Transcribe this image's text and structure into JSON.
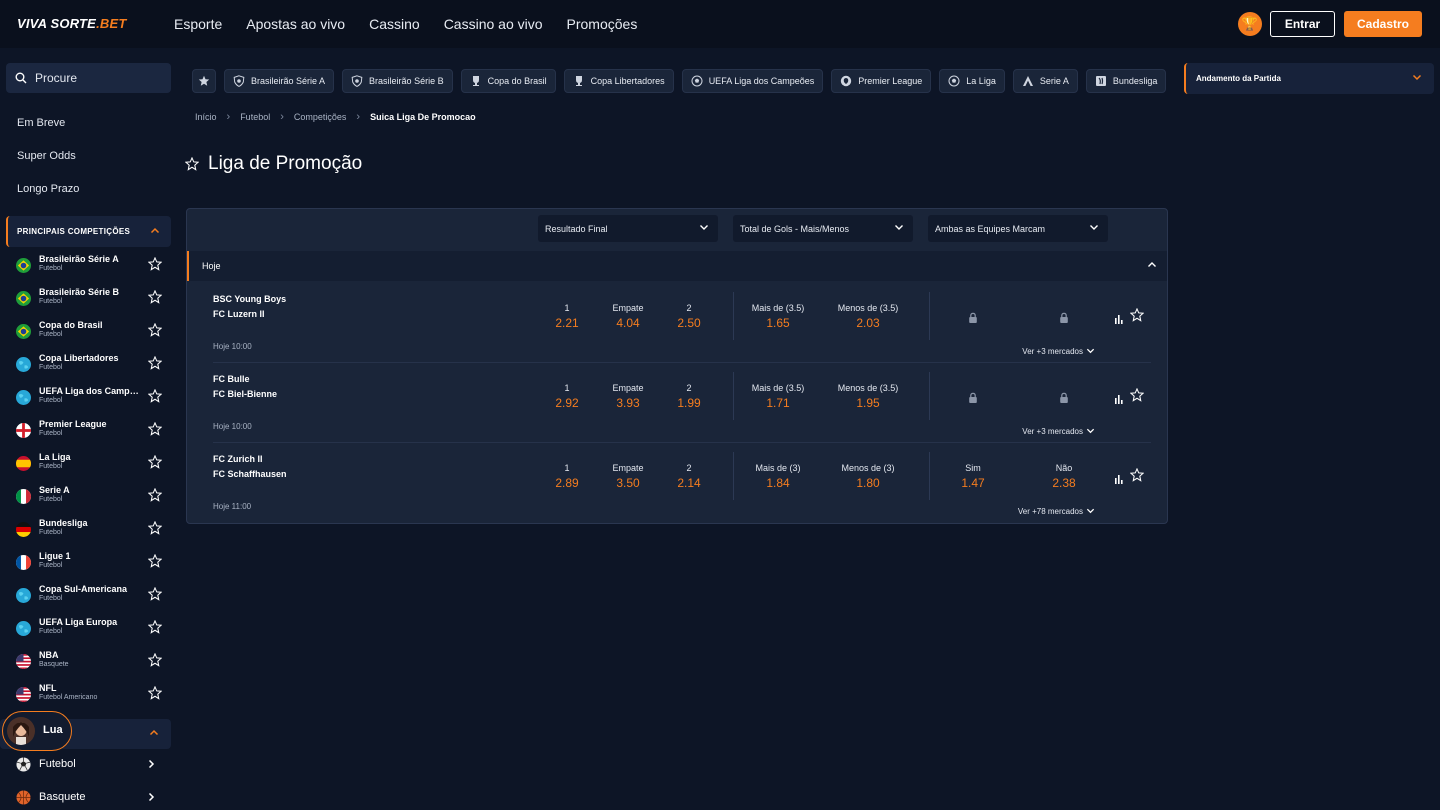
{
  "header": {
    "logo_main": "VIVA SORTE",
    "logo_accent": ".BET",
    "nav": [
      "Esporte",
      "Apostas ao vivo",
      "Cassino",
      "Cassino ao vivo",
      "Promoções"
    ],
    "login_label": "Entrar",
    "signup_label": "Cadastro"
  },
  "sidebar": {
    "search_placeholder": "Procure",
    "links": [
      "Em Breve",
      "Super Odds",
      "Longo Prazo"
    ],
    "competitions_title": "PRINCIPAIS COMPETIÇÕES",
    "competitions": [
      {
        "name": "Brasileirão Série A",
        "sport": "Futebol",
        "flag": "brazil"
      },
      {
        "name": "Brasileirão Série B",
        "sport": "Futebol",
        "flag": "brazil"
      },
      {
        "name": "Copa do Brasil",
        "sport": "Futebol",
        "flag": "brazil"
      },
      {
        "name": "Copa Libertadores",
        "sport": "Futebol",
        "flag": "globe"
      },
      {
        "name": "UEFA Liga dos Campeões",
        "sport": "Futebol",
        "flag": "globe"
      },
      {
        "name": "Premier League",
        "sport": "Futebol",
        "flag": "england"
      },
      {
        "name": "La Liga",
        "sport": "Futebol",
        "flag": "spain"
      },
      {
        "name": "Serie A",
        "sport": "Futebol",
        "flag": "italy"
      },
      {
        "name": "Bundesliga",
        "sport": "Futebol",
        "flag": "germany"
      },
      {
        "name": "Ligue 1",
        "sport": "Futebol",
        "flag": "france"
      },
      {
        "name": "Copa Sul-Americana",
        "sport": "Futebol",
        "flag": "globe"
      },
      {
        "name": "UEFA Liga Europa",
        "sport": "Futebol",
        "flag": "globe"
      },
      {
        "name": "NBA",
        "sport": "Basquete",
        "flag": "usa"
      },
      {
        "name": "NFL",
        "sport": "Futebol Americano",
        "flag": "usa"
      }
    ],
    "assistant_name": "Lua",
    "sports": [
      {
        "name": "Futebol",
        "icon": "soccer-ball"
      },
      {
        "name": "Basquete",
        "icon": "basketball"
      }
    ]
  },
  "chips": [
    {
      "label": "Brasileirão Série A",
      "icon": "shield"
    },
    {
      "label": "Brasileirão Série B",
      "icon": "shield"
    },
    {
      "label": "Copa do Brasil",
      "icon": "trophy"
    },
    {
      "label": "Copa Libertadores",
      "icon": "trophy"
    },
    {
      "label": "UEFA Liga dos Campeões",
      "icon": "ball"
    },
    {
      "label": "Premier League",
      "icon": "lion"
    },
    {
      "label": "La Liga",
      "icon": "ball"
    },
    {
      "label": "Serie A",
      "icon": "a-logo"
    },
    {
      "label": "Bundesliga",
      "icon": "bundesliga"
    }
  ],
  "right_panel": {
    "title": "Andamento da Partida"
  },
  "breadcrumb": [
    "Início",
    "Futebol",
    "Competições",
    "Suica Liga De Promocao"
  ],
  "page": {
    "title": "Liga de Promoção"
  },
  "markets": [
    "Resultado Final",
    "Total de Gols - Mais/Menos",
    "Ambas as Equipes Marcam"
  ],
  "group": {
    "label": "Hoje"
  },
  "events": [
    {
      "home": "BSC Young Boys",
      "away": "FC Luzern II",
      "time": "Hoje 10:00",
      "result": [
        {
          "label": "1",
          "value": "2.21"
        },
        {
          "label": "Empate",
          "value": "4.04"
        },
        {
          "label": "2",
          "value": "2.50"
        }
      ],
      "totals": [
        {
          "label": "Mais de (3.5)",
          "value": "1.65"
        },
        {
          "label": "Menos de (3.5)",
          "value": "2.03"
        }
      ],
      "btts": [],
      "more_label": "Ver +3 mercados"
    },
    {
      "home": "FC Bulle",
      "away": "FC Biel-Bienne",
      "time": "Hoje 10:00",
      "result": [
        {
          "label": "1",
          "value": "2.92"
        },
        {
          "label": "Empate",
          "value": "3.93"
        },
        {
          "label": "2",
          "value": "1.99"
        }
      ],
      "totals": [
        {
          "label": "Mais de (3.5)",
          "value": "1.71"
        },
        {
          "label": "Menos de (3.5)",
          "value": "1.95"
        }
      ],
      "btts": [],
      "more_label": "Ver +3 mercados"
    },
    {
      "home": "FC Zurich II",
      "away": "FC Schaffhausen",
      "time": "Hoje 11:00",
      "result": [
        {
          "label": "1",
          "value": "2.89"
        },
        {
          "label": "Empate",
          "value": "3.50"
        },
        {
          "label": "2",
          "value": "2.14"
        }
      ],
      "totals": [
        {
          "label": "Mais de (3)",
          "value": "1.84"
        },
        {
          "label": "Menos de (3)",
          "value": "1.80"
        }
      ],
      "btts": [
        {
          "label": "Sim",
          "value": "1.47"
        },
        {
          "label": "Não",
          "value": "2.38"
        }
      ],
      "more_label": "Ver +78 mercados"
    }
  ],
  "colors": {
    "accent": "#f57d1f",
    "background": "#0d1526",
    "panel": "#1a2539"
  }
}
